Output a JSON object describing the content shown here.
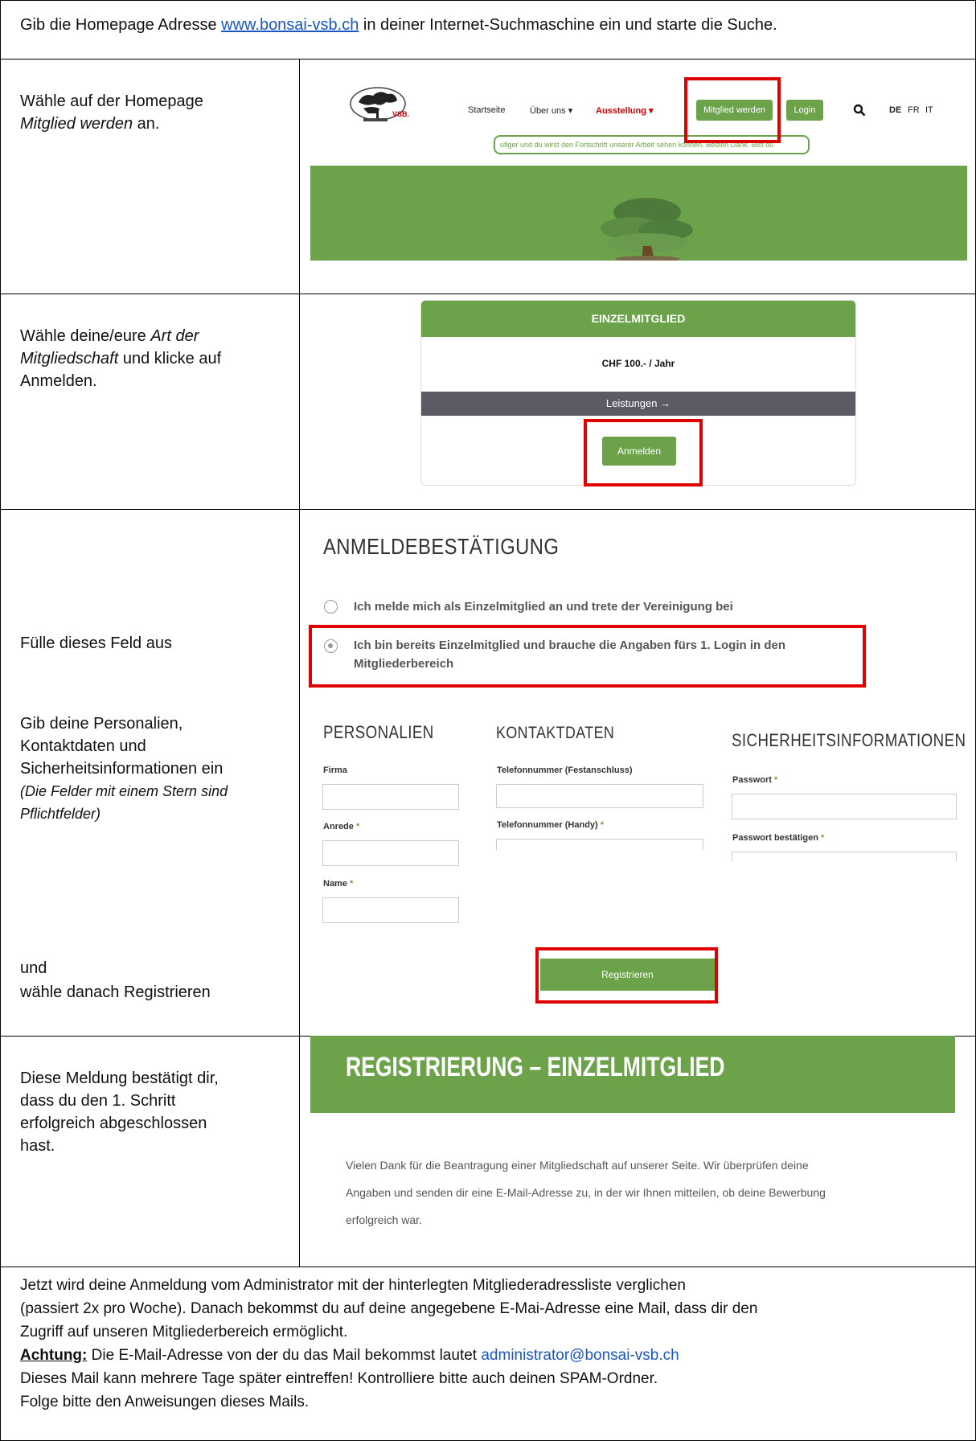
{
  "colors": {
    "accent": "#6ca34a",
    "highlight": "#e00000",
    "link": "#1a56c4",
    "dark_bar": "#5b5b66"
  },
  "intro": {
    "before": "Gib die Homepage Adresse ",
    "link": "www.bonsai-vsb.ch",
    "after": " in deiner Internet-Suchmaschine ein und starte die Suche."
  },
  "step1": {
    "line1": "Wähle auf der Homepage",
    "italic": "Mitglied werden",
    "after": " an.",
    "site": {
      "logo_text": "VSB.",
      "nav": [
        "Startseite",
        "Über uns ▾",
        "Ausstellung ▾"
      ],
      "member_button": "Mitglied werden",
      "login_button": "Login",
      "search_icon": "search-icon",
      "langs": [
        "DE",
        "FR",
        "IT"
      ],
      "ticker": "ufiger und du wirst den Fortschritt unserer Arbeit sehen können. Besten Dank.  Bist du"
    }
  },
  "step2": {
    "line1_before": "Wähle deine/eure ",
    "line1_italic": "Art der",
    "line2_italic": "Mitgliedschaft",
    "line2_after": " und klicke auf",
    "line3": "Anmelden.",
    "card": {
      "title": "EINZELMITGLIED",
      "price": "CHF 100.- / Jahr",
      "services": "Leistungen →",
      "signup": "Anmelden"
    }
  },
  "step3": {
    "fill": "Fülle dieses Feld aus",
    "p1": "Gib deine Personalien,",
    "p2": "Kontaktdaten und",
    "p3": "Sicherheitsinformationen ein",
    "p4": "(Die Felder mit einem Stern sind",
    "p5": "Pflichtfelder)",
    "and": "und",
    "then": "wähle danach Registrieren",
    "form": {
      "heading": "ANMELDEBESTÄTIGUNG",
      "option1": "Ich melde mich als Einzelmitglied an und trete der Vereinigung bei",
      "option2a": "Ich bin bereits Einzelmitglied und brauche die Angaben fürs 1. Login in den",
      "option2b": "Mitgliederbereich",
      "col1_heading": "PERSONALIEN",
      "col2_heading": "KONTAKTDATEN",
      "col3_heading": "SICHERHEITSINFORMATIONEN",
      "firma": "Firma",
      "anrede": "Anrede",
      "name": "Name",
      "tel_fest": "Telefonnummer (Festanschluss)",
      "tel_handy": "Telefonnummer (Handy)",
      "passwort": "Passwort",
      "passwort2": "Passwort bestätigen",
      "star": "*",
      "register": "Registrieren"
    }
  },
  "step4": {
    "l1": "Diese Meldung bestätigt dir,",
    "l2": "dass du den 1. Schritt",
    "l3": "erfolgreich abgeschlossen",
    "l4": "hast.",
    "banner": "REGISTRIERUNG – EINZELMITGLIED",
    "t1": "Vielen Dank für die Beantragung einer Mitgliedschaft auf unserer Seite. Wir überprüfen deine",
    "t2": "Angaben und senden dir eine E-Mail-Adresse zu, in der wir Ihnen mitteilen, ob deine Bewerbung",
    "t3": "erfolgreich war."
  },
  "footer": {
    "l1": "Jetzt wird deine Anmeldung vom Administrator mit der hinterlegten Mitgliederadressliste verglichen",
    "l2": "(passiert 2x pro Woche). Danach bekommst du auf deine angegebene E-Mai-Adresse eine Mail, dass dir den",
    "l3": "Zugriff auf unseren Mitgliederbereich ermöglicht.",
    "warn_label": "Achtung:",
    "warn_text": " Die E-Mail-Adresse von der du das Mail bekommst lautet ",
    "email": "administrator@bonsai-vsb.ch",
    "l5": "Dieses Mail kann mehrere Tage später eintreffen! Kontrolliere bitte auch deinen SPAM-Ordner.",
    "l6": "Folge bitte den Anweisungen dieses Mails."
  }
}
